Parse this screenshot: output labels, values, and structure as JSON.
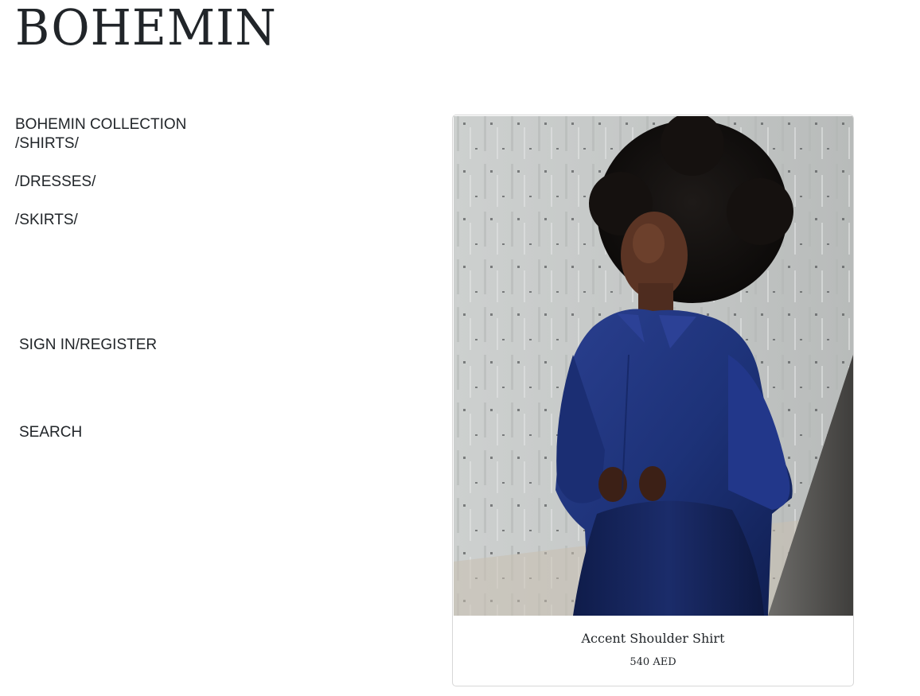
{
  "brand": {
    "logo_text": "BOHEMIN"
  },
  "nav": {
    "collection_title": "BOHEMIN COLLECTION",
    "items": [
      {
        "label": "/SHIRTS/"
      },
      {
        "label": "/DRESSES/"
      },
      {
        "label": "/SKIRTS/"
      }
    ],
    "account_label": "SIGN IN/REGISTER",
    "search_label": "SEARCH"
  },
  "products": [
    {
      "name": "Accent Shoulder Shirt",
      "price": "540 AED",
      "image_alt": "Accent Shoulder Shirt"
    }
  ],
  "colors": {
    "text": "#212529",
    "card_border": "#d7d7d7",
    "shirt": "#1d3278",
    "wall": "#c9cccb"
  }
}
